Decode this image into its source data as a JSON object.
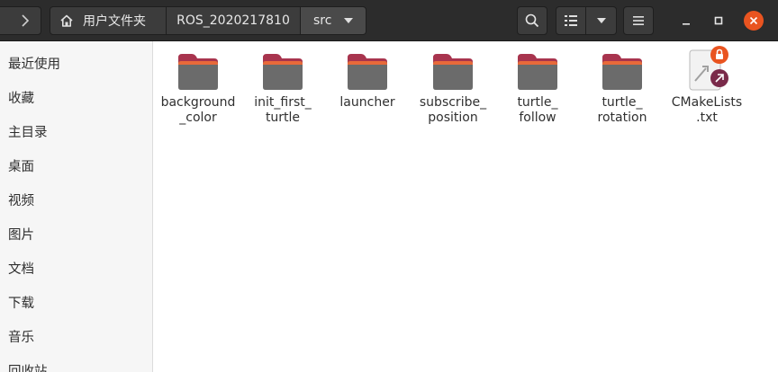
{
  "colors": {
    "headerbar": "#2c2c2c",
    "accent": "#e95420",
    "folder_top": "#a8344e",
    "folder_body": "#6b6b6b",
    "sidebar_bg": "#f6f6f6"
  },
  "header": {
    "breadcrumbs": [
      {
        "label": "用户文件夹",
        "icon": "home-icon"
      },
      {
        "label": "ROS_2020217810"
      },
      {
        "label": "src",
        "icon": "chevron-down-icon"
      }
    ],
    "buttons": {
      "forward": "chevron-right-icon",
      "search": "search-icon",
      "view_list": "list-view-icon",
      "view_options": "chevron-down-icon",
      "menu": "hamburger-menu-icon",
      "minimize": "minimize-icon",
      "maximize": "maximize-icon",
      "close": "close-icon"
    }
  },
  "sidebar": {
    "items": [
      {
        "label": "最近使用"
      },
      {
        "label": "收藏"
      },
      {
        "label": "主目录"
      },
      {
        "label": "桌面"
      },
      {
        "label": "视频"
      },
      {
        "label": "图片"
      },
      {
        "label": "文档"
      },
      {
        "label": "下载"
      },
      {
        "label": "音乐"
      },
      {
        "label": "回收站"
      }
    ]
  },
  "files": [
    {
      "name": "background\n_color",
      "type": "folder"
    },
    {
      "name": "init_first_\nturtle",
      "type": "folder"
    },
    {
      "name": "launcher",
      "type": "folder"
    },
    {
      "name": "subscribe_\nposition",
      "type": "folder"
    },
    {
      "name": "turtle_\nfollow",
      "type": "folder"
    },
    {
      "name": "turtle_\nrotation",
      "type": "folder"
    },
    {
      "name": "CMakeLists\n.txt",
      "type": "symlink-file",
      "emblems": [
        "lock-icon",
        "symlink-arrow-icon"
      ]
    }
  ]
}
